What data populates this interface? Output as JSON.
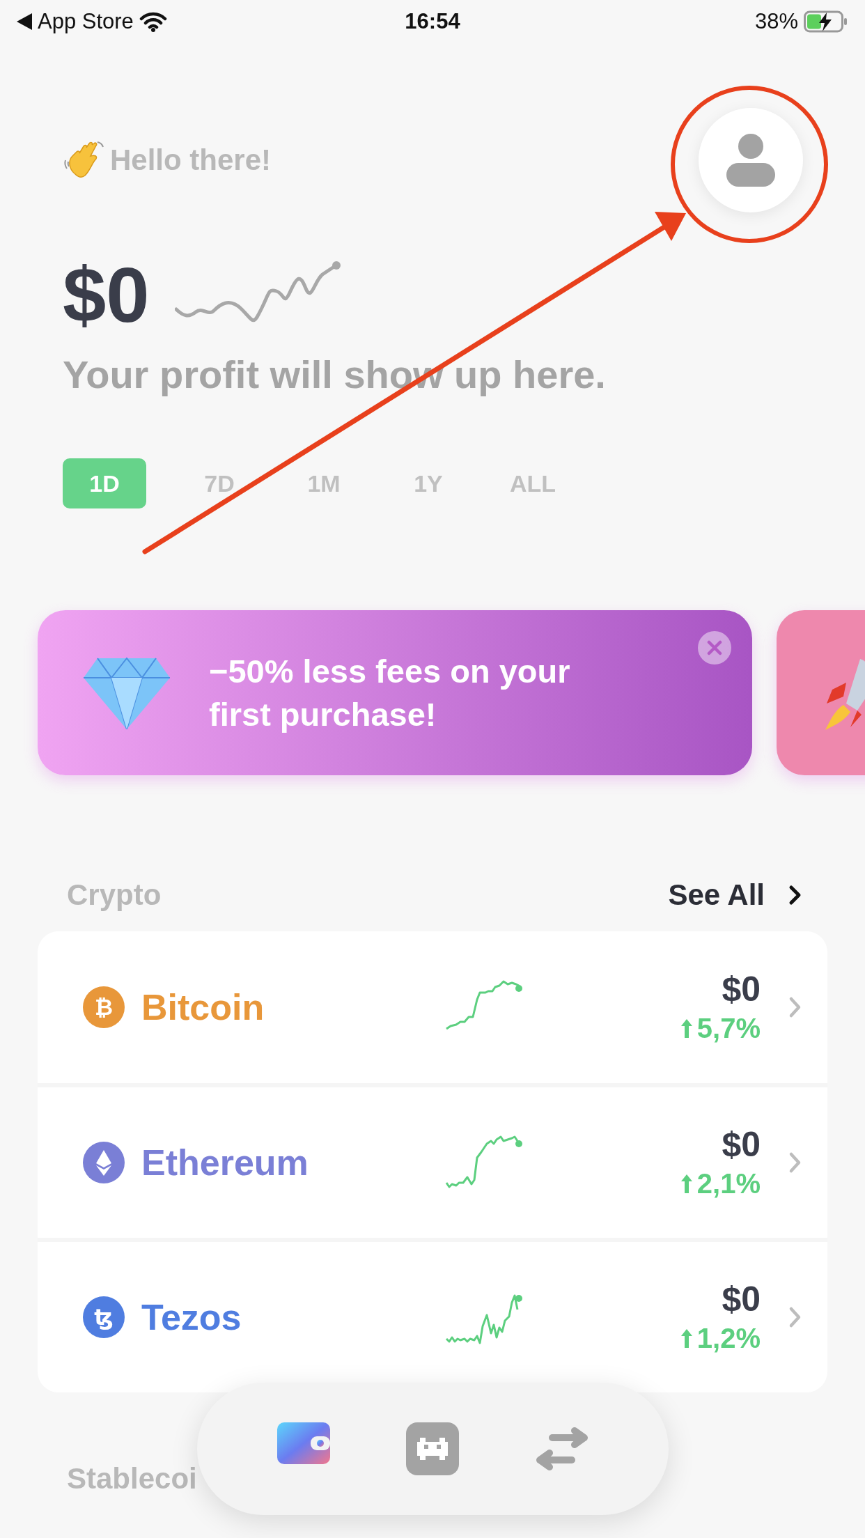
{
  "status_bar": {
    "back_label": "App Store",
    "time": "16:54",
    "battery": "38%"
  },
  "greeting": {
    "text": "Hello there!"
  },
  "balance": {
    "amount": "$0",
    "caption": "Your profit will show up here."
  },
  "periods": [
    {
      "label": "1D",
      "selected": true
    },
    {
      "label": "7D",
      "selected": false
    },
    {
      "label": "1M",
      "selected": false
    },
    {
      "label": "1Y",
      "selected": false
    },
    {
      "label": "ALL",
      "selected": false
    }
  ],
  "promos": [
    {
      "kind": "diamond",
      "text": "−50% less fees on your first purchase!"
    },
    {
      "kind": "rocket"
    }
  ],
  "crypto": {
    "title": "Crypto",
    "see_all": "See All",
    "assets": [
      {
        "kind": "bitcoin",
        "symbol": "₿",
        "name": "Bitcoin",
        "color": "#e8973a",
        "price": "$0",
        "change": "5,7%"
      },
      {
        "kind": "ethereum",
        "name": "Ethereum",
        "color": "#7a7fd6",
        "price": "$0",
        "change": "2,1%"
      },
      {
        "kind": "tezos",
        "symbol": "ꜩ",
        "name": "Tezos",
        "color": "#4f7de0",
        "price": "$0",
        "change": "1,2%"
      }
    ]
  },
  "stablecoins": {
    "title": "Stablecoi"
  },
  "nav": [
    {
      "kind": "wallet",
      "selected": true
    },
    {
      "kind": "invader",
      "selected": false
    },
    {
      "kind": "transfer",
      "selected": false
    }
  ]
}
